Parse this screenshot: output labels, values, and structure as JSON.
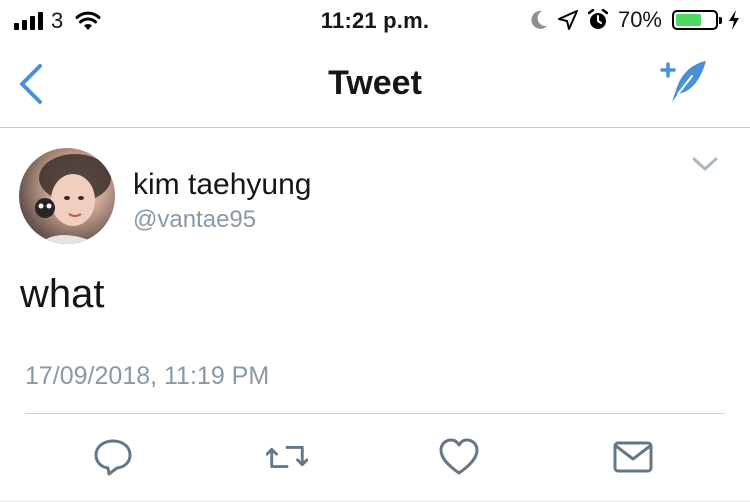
{
  "status_bar": {
    "carrier": "3",
    "time": "11:21 p.m.",
    "battery_percent": "70%",
    "battery_level": 0.7,
    "icons": [
      "signal-icon",
      "wifi-icon",
      "moon-icon",
      "location-icon",
      "alarm-icon",
      "battery-icon",
      "charging-icon"
    ]
  },
  "nav": {
    "title": "Tweet",
    "back_icon": "chevron-left-icon",
    "compose_icon": "compose-tweet-icon"
  },
  "tweet": {
    "display_name": "kim taehyung",
    "username": "@vantae95",
    "text": "what",
    "timestamp": "17/09/2018, 11:19 PM"
  },
  "actions": [
    {
      "name": "reply",
      "icon": "reply-icon"
    },
    {
      "name": "retweet",
      "icon": "retweet-icon"
    },
    {
      "name": "like",
      "icon": "heart-icon"
    },
    {
      "name": "share",
      "icon": "mail-icon"
    }
  ],
  "colors": {
    "accent": "#4a90d9",
    "text_primary": "#14171a",
    "text_secondary": "#8899a6",
    "battery_green": "#4cd964"
  }
}
